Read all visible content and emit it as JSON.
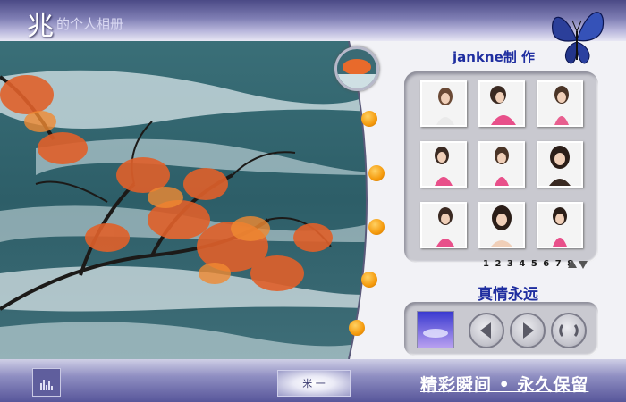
{
  "header": {
    "logo_text": "兆",
    "title": "的个人相册"
  },
  "main_photo": {
    "description_icon": "river-autumn-photo",
    "preview_icon": "photo-preview-icon",
    "side_buttons": [
      "dot",
      "dot",
      "dot",
      "dot",
      "dot"
    ]
  },
  "gallery": {
    "credit": "jankne制 作",
    "thumbnails": [
      {
        "icon": "portrait-thumbnail"
      },
      {
        "icon": "portrait-thumbnail"
      },
      {
        "icon": "portrait-thumbnail"
      },
      {
        "icon": "portrait-thumbnail"
      },
      {
        "icon": "portrait-thumbnail"
      },
      {
        "icon": "portrait-thumbnail"
      },
      {
        "icon": "portrait-thumbnail"
      },
      {
        "icon": "portrait-thumbnail"
      },
      {
        "icon": "portrait-thumbnail"
      }
    ],
    "pages": [
      "1",
      "2",
      "3",
      "4",
      "5",
      "6",
      "7",
      "8"
    ],
    "motto": "真情永远"
  },
  "controls": {
    "prev_icon": "prev-icon",
    "next_icon": "next-icon",
    "loop_icon": "loop-icon"
  },
  "footer": {
    "music_label": "米 一",
    "slogan": "精彩瞬间 • 永久保留"
  },
  "colors": {
    "accent_blue": "#1f2ea0",
    "orange_dot": "#f59a0c",
    "header_purple": "#5b5a95"
  }
}
